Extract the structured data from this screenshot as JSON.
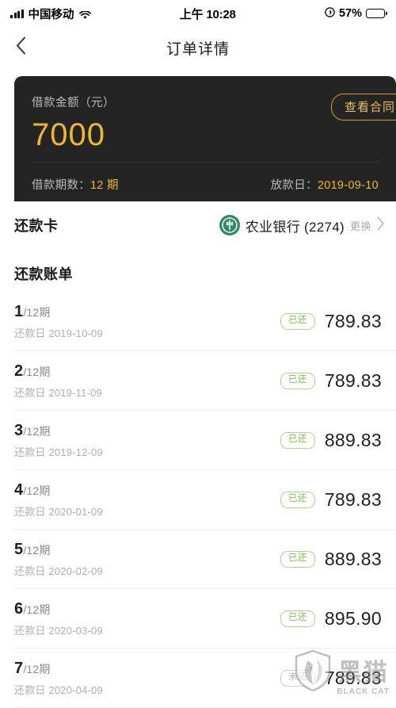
{
  "statusbar": {
    "signal_icon": "signal-bars-icon",
    "carrier": "中国移动",
    "wifi_icon": "wifi-icon",
    "time": "上午 10:28",
    "location_icon": "location-arrow-icon",
    "battery_percent": "57%",
    "battery_level": 57,
    "battery_icon": "battery-icon"
  },
  "header": {
    "back_icon": "chevron-left-icon",
    "title": "订单详情"
  },
  "loan_card": {
    "amount_label": "借款金额（元）",
    "amount": "7000",
    "contract_button": "查看合同",
    "term_label": "借款期数：",
    "term_value": "12 期",
    "disburse_label": "放款日：",
    "disburse_value": "2019-09-10",
    "bg_color": "#242424",
    "accent_color": "#ecb731"
  },
  "repayment_card": {
    "title": "还款卡",
    "bank_logo_icon": "abc-bank-logo-icon",
    "bank_name": "农业银行 (2274)",
    "change_label": "更换",
    "chevron_icon": "chevron-right-icon",
    "logo_color": "#2e8b63"
  },
  "bills": {
    "title": "还款账单",
    "paid_status": "已还",
    "unpaid_status": "未还",
    "paid_color": "#7cc24f",
    "unpaid_color": "#b5b5b5",
    "date_prefix": "还款日",
    "rows": [
      {
        "index": "1",
        "period": "/12期",
        "date": "还款日 2019-10-09",
        "status": "已还",
        "paid": true,
        "amount": "789.83"
      },
      {
        "index": "2",
        "period": "/12期",
        "date": "还款日 2019-11-09",
        "status": "已还",
        "paid": true,
        "amount": "789.83"
      },
      {
        "index": "3",
        "period": "/12期",
        "date": "还款日 2019-12-09",
        "status": "已还",
        "paid": true,
        "amount": "889.83"
      },
      {
        "index": "4",
        "period": "/12期",
        "date": "还款日 2020-01-09",
        "status": "已还",
        "paid": true,
        "amount": "789.83"
      },
      {
        "index": "5",
        "period": "/12期",
        "date": "还款日 2020-02-09",
        "status": "已还",
        "paid": true,
        "amount": "889.83"
      },
      {
        "index": "6",
        "period": "/12期",
        "date": "还款日 2020-03-09",
        "status": "已还",
        "paid": true,
        "amount": "895.90"
      },
      {
        "index": "7",
        "period": "/12期",
        "date": "还款日 2020-04-09",
        "status": "未还",
        "paid": false,
        "amount": "789.83"
      }
    ]
  },
  "watermark": {
    "cn": "黑猫",
    "en": "BLACK CAT",
    "shield_icon": "cat-shield-icon"
  }
}
